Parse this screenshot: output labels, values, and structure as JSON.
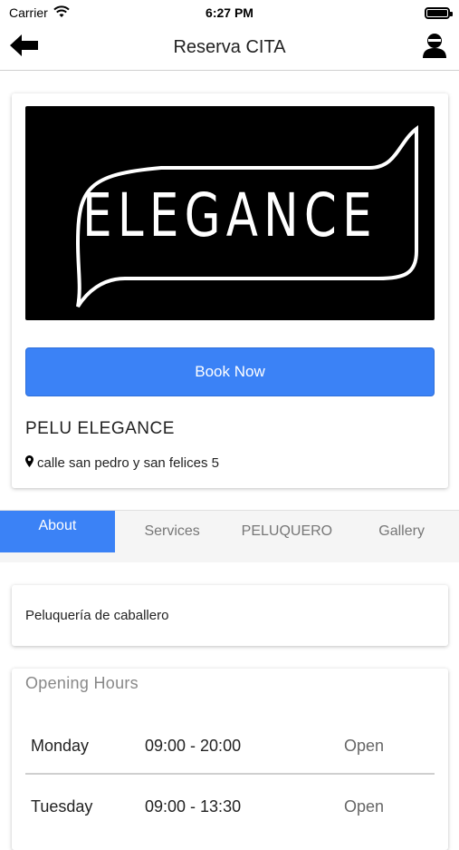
{
  "status_bar": {
    "carrier": "Carrier",
    "time": "6:27 PM",
    "icons": [
      "wifi-icon",
      "battery-icon"
    ]
  },
  "navbar": {
    "title": "Reserva CITA",
    "back_icon": "arrow-left-icon",
    "profile_icon": "user-avatar-icon"
  },
  "business": {
    "logo_text": "ELEGANCE",
    "book_label": "Book Now",
    "name": "PELU ELEGANCE",
    "address": "calle san pedro y san felices 5",
    "address_icon": "map-marker-icon"
  },
  "tabs": [
    {
      "label": "About",
      "active": true
    },
    {
      "label": "Services",
      "active": false
    },
    {
      "label": "PELUQUERO",
      "active": false
    },
    {
      "label": "Gallery",
      "active": false
    }
  ],
  "about": {
    "description": "Peluquería de caballero"
  },
  "opening_hours": {
    "title": "Opening Hours",
    "rows": [
      {
        "day": "Monday",
        "time": "09:00 - 20:00",
        "status": "Open"
      },
      {
        "day": "Tuesday",
        "time": "09:00 - 13:30",
        "status": "Open"
      }
    ]
  },
  "colors": {
    "accent": "#3b82f6",
    "tab_bg": "#f5f5f5",
    "logo_bg": "#000000"
  }
}
